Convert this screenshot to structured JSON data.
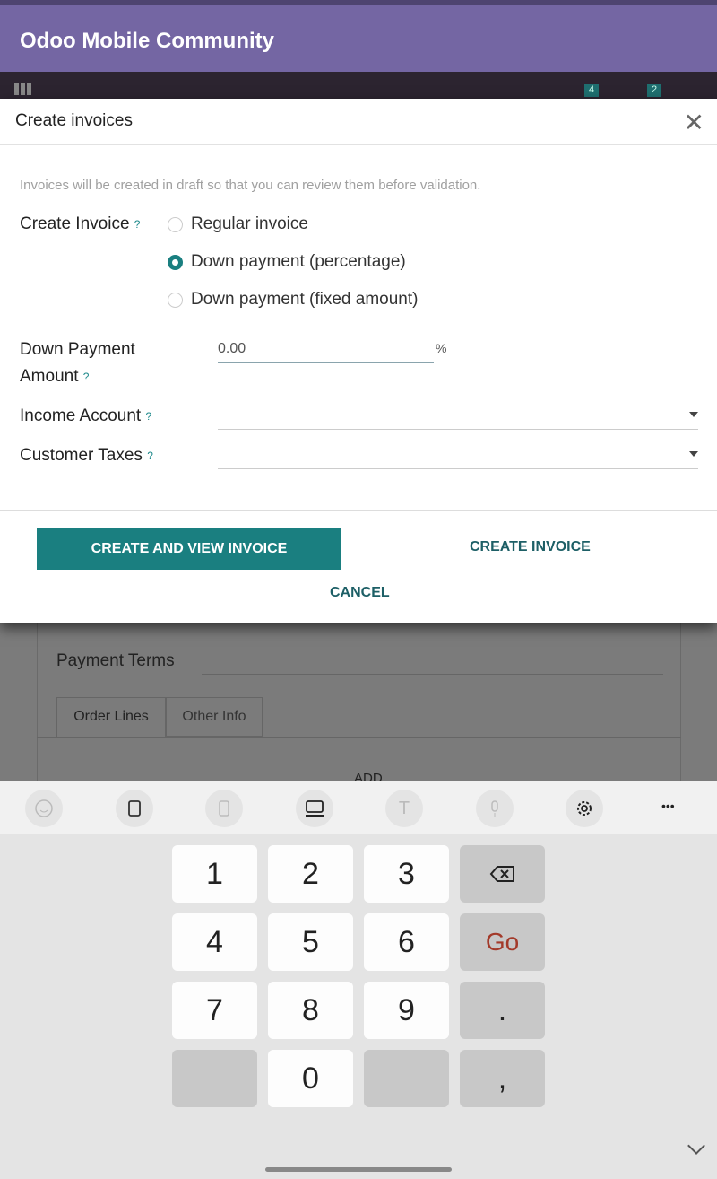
{
  "app": {
    "title": "Odoo Mobile Community",
    "badges": {
      "messages": "4",
      "activities": "2"
    }
  },
  "dialog": {
    "title": "Create invoices",
    "note": "Invoices will be created in draft so that you can review them before validation.",
    "create_invoice_label": "Create Invoice",
    "help_mark": "?",
    "options": [
      {
        "label": "Regular invoice",
        "selected": false
      },
      {
        "label": "Down payment (percentage)",
        "selected": true
      },
      {
        "label": "Down payment (fixed amount)",
        "selected": false
      }
    ],
    "down_payment_label_1": "Down Payment",
    "down_payment_label_2": "Amount",
    "down_payment_value": "0.00",
    "percent_sign": "%",
    "income_account_label": "Income Account",
    "customer_taxes_label": "Customer Taxes",
    "buttons": {
      "create_view": "CREATE AND VIEW INVOICE",
      "create": "CREATE INVOICE",
      "cancel": "CANCEL"
    }
  },
  "background": {
    "payment_terms_label": "Payment Terms",
    "tabs": [
      "Order Lines",
      "Other Info"
    ],
    "add_label": "ADD"
  },
  "keyboard": {
    "keys": [
      "1",
      "2",
      "3",
      "4",
      "5",
      "6",
      "7",
      "8",
      "9",
      "0"
    ],
    "go": "Go",
    "dot": ".",
    "comma": ",",
    "more": "•••",
    "accent": "#1a7f80",
    "go_color": "#a33a2a"
  }
}
